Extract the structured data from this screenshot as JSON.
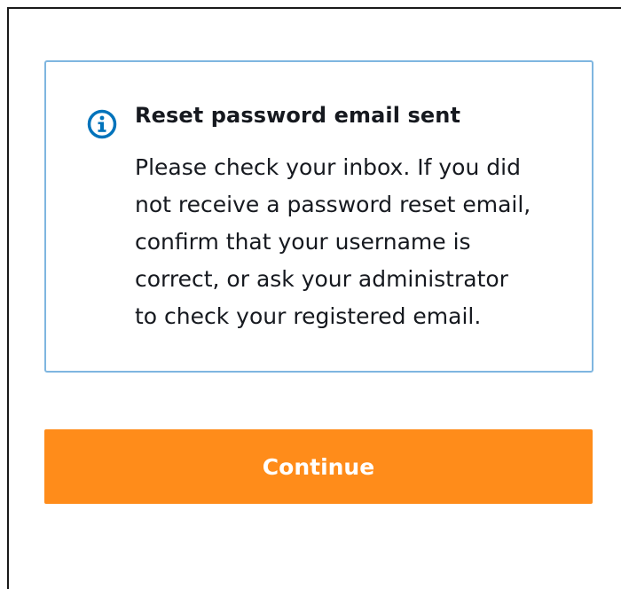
{
  "alert": {
    "icon": "info-circle-icon",
    "title": "Reset password email sent",
    "body_lines": [
      "Please check your inbox. If you did",
      "not receive a password reset email,",
      "confirm that your username is",
      "correct, or ask your administrator",
      "to check your registered email."
    ],
    "border_color": "#7fb6e0",
    "icon_color": "#0073bb"
  },
  "actions": {
    "continue_label": "Continue",
    "continue_color": "#ff8c1a"
  }
}
